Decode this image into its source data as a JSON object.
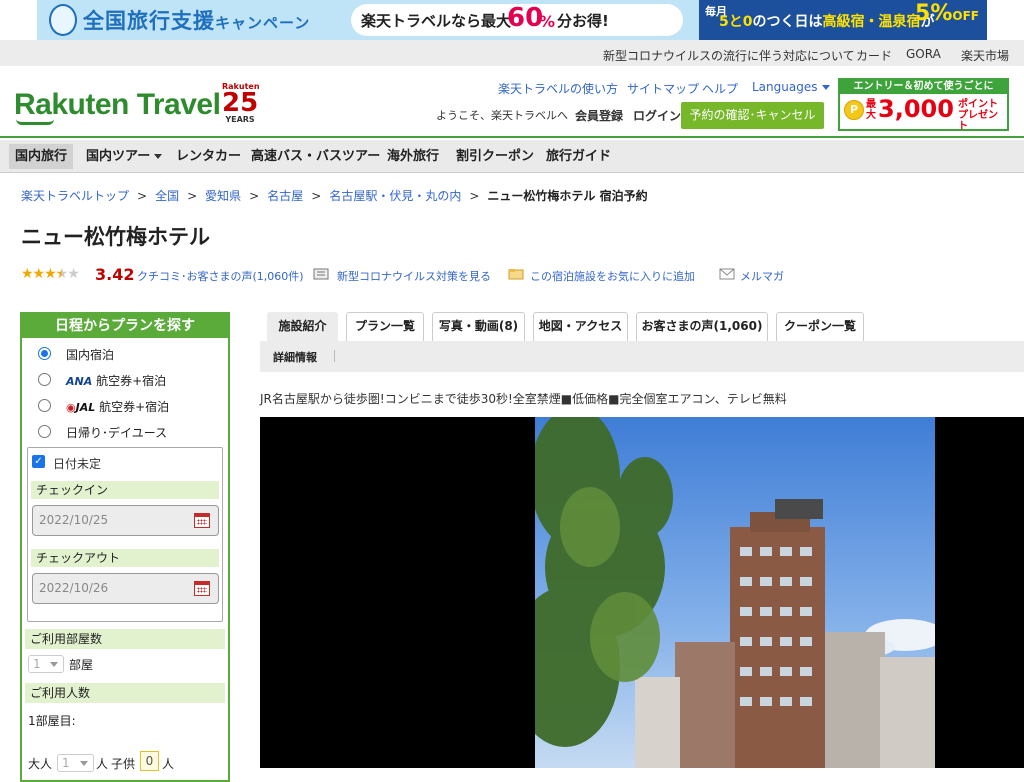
{
  "banner": {
    "title": "全国旅行支援",
    "title_sub": "キャンペーン",
    "pill_prefix": "楽天トラベルなら最大",
    "pill_big": "60",
    "pill_pct": "%",
    "pill_suffix": "分お得!",
    "right_month": "毎月",
    "right_text_1": "5と0",
    "right_text_2": "のつく日は",
    "right_text_3": "高級宿・温泉宿",
    "right_text_4": "が",
    "right_off": "5%",
    "right_off_word": "OFF"
  },
  "util_links": [
    "新型コロナウイルスの流行に伴う対応について",
    "カード",
    "GORA",
    "楽天市場"
  ],
  "header": {
    "logo": "Rakuten Travel",
    "anniv_brand": "Rakuten",
    "anniv_number": "25",
    "anniv_years": "YEARS",
    "links": [
      "楽天トラベルの使い方",
      "サイトマップ",
      "ヘルプ"
    ],
    "languages": "Languages",
    "welcome": "ようこそ、楽天トラベルへ",
    "register": "会員登録",
    "login": "ログイン",
    "reserve_button": "予約の確認･キャンセル",
    "promo_top": "エントリー＆初めて使うごとに",
    "promo_coin": "P",
    "promo_max": "最大",
    "promo_amount": "3,000",
    "promo_points": "ポイント プレゼント"
  },
  "nav": [
    "国内旅行",
    "国内ツアー",
    "レンタカー",
    "高速バス・バスツアー",
    "海外旅行",
    "割引クーポン",
    "旅行ガイド"
  ],
  "breadcrumb": [
    "楽天トラベルトップ",
    "全国",
    "愛知県",
    "名古屋",
    "名古屋駅・伏見・丸の内"
  ],
  "breadcrumb_current": "ニュー松竹梅ホテル 宿泊予約",
  "hotel": {
    "name": "ニュー松竹梅ホテル",
    "rating": "3.42",
    "stars_filled": "★★★",
    "stars_half": "★",
    "stars_empty": "★",
    "reviews_link": "クチコミ･お客さまの声(1,060件)",
    "covid_link": "新型コロナウイルス対策を見る",
    "favorite_link": "この宿泊施設をお気に入りに追加",
    "mail_link": "メルマガ",
    "catchcopy": "JR名古屋駅から徒歩圏!コンビニまで徒歩30秒!全室禁煙■低価格■完全個室エアコン、テレビ無料"
  },
  "search": {
    "title": "日程からプランを探す",
    "types": [
      "国内宿泊",
      "航空券+宿泊",
      "航空券+宿泊",
      "日帰り･デイユース"
    ],
    "ana": "ANA",
    "jal": "JAL",
    "date_undecided": "日付未定",
    "checkin_label": "チェックイン",
    "checkin_value": "2022/10/25",
    "checkout_label": "チェックアウト",
    "checkout_value": "2022/10/26",
    "rooms_label": "ご利用部屋数",
    "rooms_value": "1",
    "rooms_unit": "部屋",
    "guests_label": "ご利用人数",
    "room1_label": "1部屋目:",
    "adult_label": "大人",
    "adult_value": "1",
    "adult_unit": "人",
    "child_label": "子供",
    "child_value": "0",
    "child_unit": "人"
  },
  "tabs": [
    "施設紹介",
    "プラン一覧",
    "写真・動画(8)",
    "地図・アクセス",
    "お客さまの声(1,060)",
    "クーポン一覧"
  ],
  "subtab": "詳細情報",
  "colors": {
    "green": "#5aab3a",
    "red": "#bf0000",
    "link": "#3366cc"
  }
}
